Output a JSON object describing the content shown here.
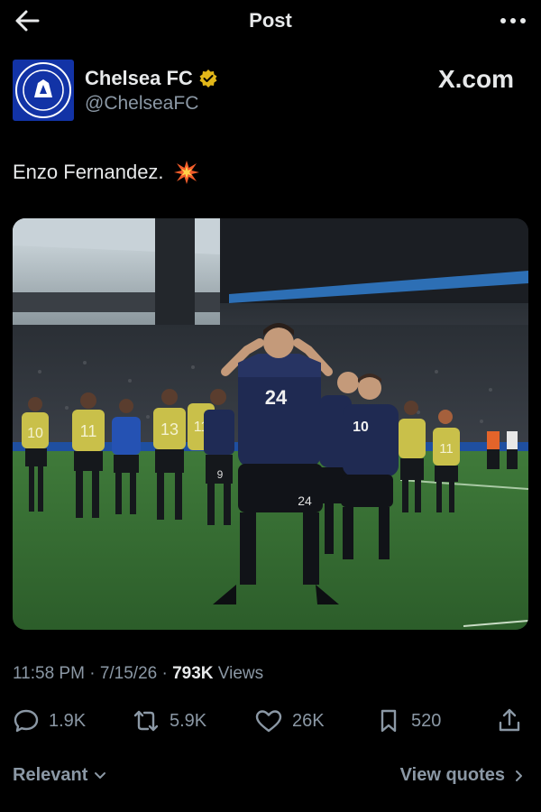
{
  "header": {
    "title": "Post",
    "back_icon": "arrow-left-icon",
    "more_icon": "more-horizontal-icon"
  },
  "author": {
    "name": "Chelsea FC",
    "handle": "@ChelseaFC",
    "verified_color": "#e2b719",
    "crest_color": "#1233a6",
    "crest_text": "CHELSEA FOOTBALL CLUB"
  },
  "watermark": "X.com",
  "post": {
    "text": "Enzo Fernandez.",
    "emoji_icon": "collision-icon"
  },
  "media": {
    "alt": "photo",
    "jersey_primary": "24",
    "jersey_secondary": "10",
    "jersey_back": "24",
    "bib_numbers": [
      "10",
      "11",
      "13",
      "11",
      "9",
      "11"
    ]
  },
  "meta": {
    "time": "11:58 PM",
    "separator1": " · ",
    "date": "7/15/26",
    "separator2": " · ",
    "views_count": "793K",
    "views_label": " Views"
  },
  "actions": {
    "replies": "1.9K",
    "reposts": "5.9K",
    "likes": "26K",
    "bookmarks": "520"
  },
  "footer": {
    "relevant_label": "Relevant",
    "view_quotes_label": "View quotes"
  }
}
